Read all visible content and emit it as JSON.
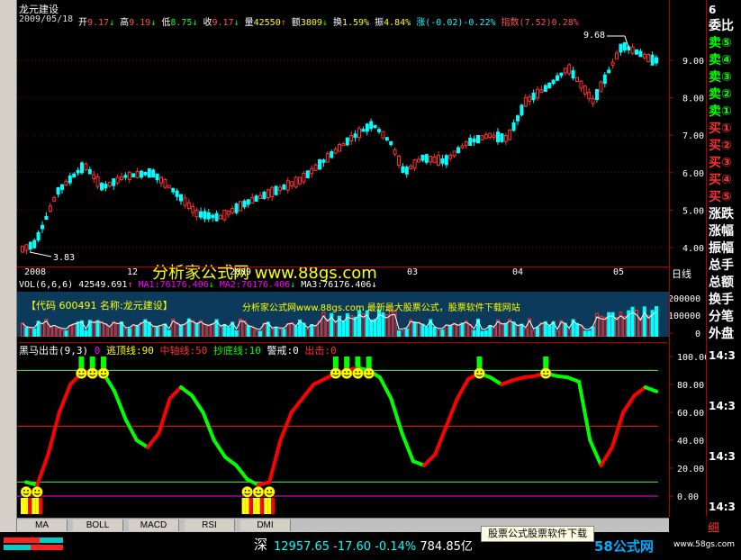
{
  "stock_name": "龙元建设",
  "header": {
    "date": "2009/05/18",
    "open_label": "开",
    "open": "9.17",
    "open_arrow": "↓",
    "high_label": "高",
    "high": "9.19",
    "high_arrow": "↓",
    "low_label": "低",
    "low": "8.75",
    "low_arrow": "↓",
    "close_label": "收",
    "close": "9.17",
    "close_arrow": "↓",
    "volume_label": "量",
    "volume": "42550",
    "volume_arrow": "↑",
    "amount_label": "额",
    "amount": "3809",
    "amount_arrow": "↓",
    "turnover_label": "换",
    "turnover": "1.59%",
    "amplitude_label": "振",
    "amplitude": "4.84%",
    "change_label": "涨",
    "change": "(-0.02)-0.22%",
    "index_label": "指数",
    "index": "(7.52)0.28%"
  },
  "price_chart": {
    "y_ticks": [
      "9.00",
      "8.00",
      "7.00",
      "6.00",
      "5.00",
      "4.00"
    ],
    "high_marker": "9.68",
    "low_marker": "3.83",
    "x_labels": [
      "2008",
      "12",
      "2009",
      "03",
      "04",
      "05"
    ],
    "period_label": "日线",
    "watermark": "分析家公式网 www.88gs.com"
  },
  "volume_chart": {
    "header": {
      "title": "VOL(6,6,6)",
      "vol_value": "42549.691",
      "vol_arrow": "↑",
      "ma1": "MA1:76176.406",
      "ma1_arrow": "↓",
      "ma2": "MA2:76176.406",
      "ma2_arrow": "↓",
      "ma3": "MA3:76176.406",
      "ma3_arrow": "↓"
    },
    "y_ticks": [
      "200000",
      "100000",
      "0"
    ],
    "banner_left": "【代码 600491 名称:龙元建设】",
    "banner_right": "分析家公式网www.88gs.com 最新最大股票公式，股票软件下载网站"
  },
  "indicator": {
    "header": {
      "title": "黑马出击(9,3)",
      "v0": "0",
      "escape_label": "逃顶线:90",
      "mid_label": "中轴线:50",
      "bottom_label": "抄底线:10",
      "alert_label": "警戒:0",
      "strike_label": "出击:0"
    },
    "y_ticks": [
      "100.00",
      "80.00",
      "60.00",
      "40.00",
      "20.00",
      "0.00"
    ],
    "chart_data": {
      "type": "line",
      "series": [
        {
          "values": [
            10,
            8,
            30,
            60,
            80,
            88,
            90,
            88,
            75,
            55,
            40,
            35,
            45,
            70,
            78,
            72,
            60,
            40,
            28,
            22,
            12,
            8,
            10,
            40,
            60,
            70,
            80,
            84,
            88,
            90,
            92,
            90,
            85,
            70,
            45,
            25,
            22,
            30,
            50,
            70,
            84,
            88,
            85,
            80,
            83,
            85,
            86,
            88,
            86,
            85,
            82,
            40,
            22,
            35,
            60,
            72,
            78,
            75
          ]
        }
      ],
      "hlines": [
        90,
        50,
        10,
        0
      ],
      "ylim": [
        -5,
        105
      ]
    }
  },
  "tabs": [
    "MA",
    "BOLL",
    "MACD",
    "RSI",
    "DMI"
  ],
  "right_panel": {
    "top_label": "6",
    "items": [
      "委比",
      "卖⑤",
      "卖④",
      "卖③",
      "卖②",
      "卖①",
      "买①",
      "买②",
      "买③",
      "买④",
      "买⑤",
      "涨跌",
      "涨幅",
      "振幅",
      "总手",
      "总额",
      "换手",
      "分笔",
      "外盘"
    ],
    "times": [
      "14:3",
      "14:3",
      "14:3",
      "14:3"
    ],
    "bottom_label": "细"
  },
  "status": {
    "market": "深",
    "index_value": "12957.65",
    "index_change": "-17.60",
    "index_pct": "-0.14%",
    "turnover": "784.85亿",
    "promo": "股票公式股票软件下载",
    "site_logo": "58公式网",
    "site_url": "www.58gs.com"
  },
  "colors": {
    "up": "#ff3030",
    "down": "#00ffff",
    "accent_yellow": "#ffff00",
    "ma_magenta": "#ff00ff",
    "red_line": "#ff0000",
    "green_line": "#00ff00"
  }
}
